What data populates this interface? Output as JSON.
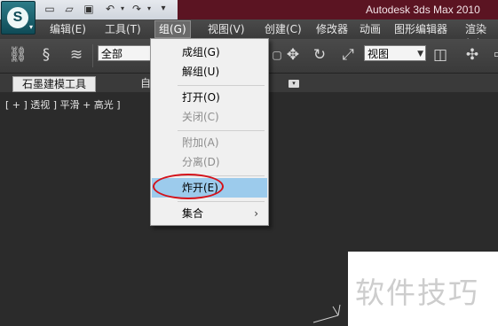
{
  "window": {
    "title": "Autodesk 3ds Max  2010"
  },
  "quick_access": [
    "new-icon",
    "open-icon",
    "save-icon",
    "undo-icon",
    "redo-icon",
    "customize-icon"
  ],
  "menubar": {
    "items": [
      "编辑(E)",
      "工具(T)",
      "组(G)",
      "视图(V)",
      "创建(C)",
      "修改器",
      "动画",
      "图形编辑器",
      "渲染(R)"
    ],
    "active_index": 2
  },
  "toolbar": {
    "selection_filter": "全部",
    "reference_coord": "视图"
  },
  "ribbon": {
    "tabs": [
      "石墨建模工具",
      "自"
    ]
  },
  "viewport": {
    "label": "[ + ] 透视 ] 平滑 + 高光 ]"
  },
  "group_menu": {
    "items": [
      {
        "label": "成组(G)",
        "enabled": true
      },
      {
        "label": "解组(U)",
        "enabled": true
      },
      {
        "label": "打开(O)",
        "enabled": true
      },
      {
        "label": "关闭(C)",
        "enabled": false
      },
      {
        "label": "附加(A)",
        "enabled": false
      },
      {
        "label": "分离(D)",
        "enabled": false
      },
      {
        "label": "炸开(E)",
        "enabled": true,
        "highlighted": true,
        "circled": true
      },
      {
        "label": "集合",
        "enabled": true,
        "submenu": true
      }
    ],
    "submenu_arrow": "›"
  },
  "watermark": "软件技巧",
  "colors": {
    "highlight": "#9ccbec",
    "annotation_circle": "#d4121a",
    "title_bar": "#5b1422"
  }
}
